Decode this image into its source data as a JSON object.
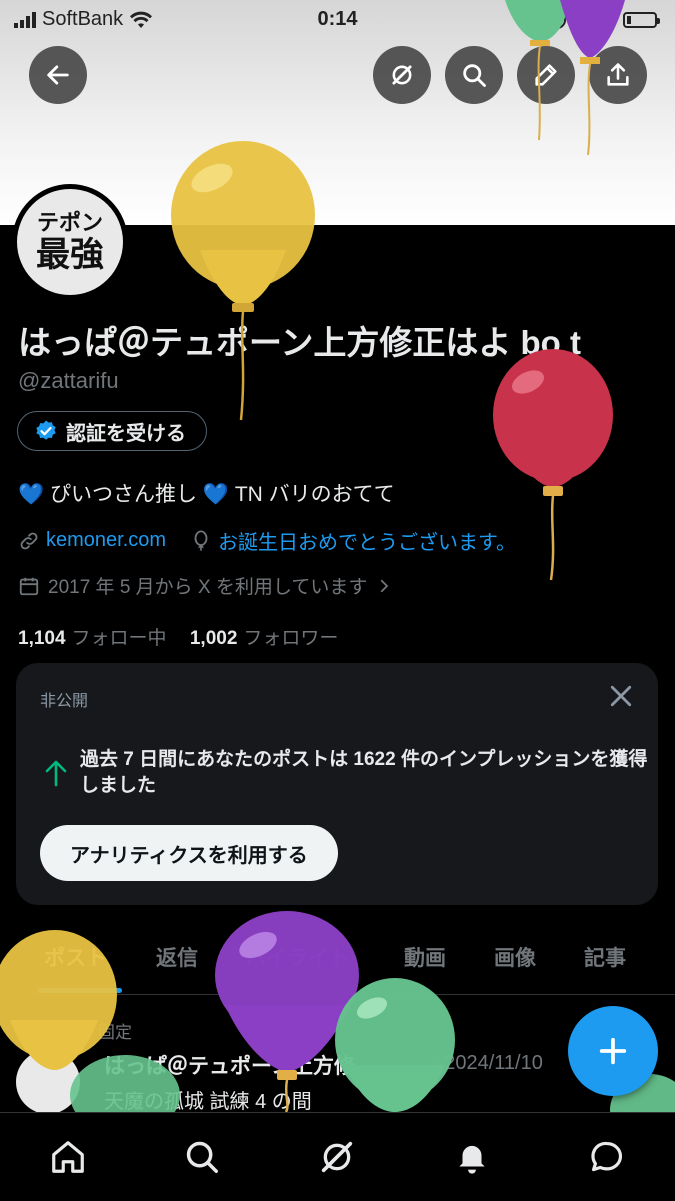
{
  "status_bar": {
    "carrier": "SoftBank",
    "time": "0:14",
    "battery": "14%",
    "battery_level": 0.14
  },
  "profile": {
    "avatar_text_top": "テポン",
    "avatar_text_bottom": "最強",
    "display_name": "はっぱ＠テュポーン上方修正はよ bo t",
    "handle": "@zattarifu",
    "verify_label": "認証を受ける",
    "bio_part1": "ぴいつさん推し",
    "bio_part2": "TN バリのおてて",
    "website": "kemoner.com",
    "birthday": "お誕生日おめでとうございます。",
    "joined": "2017 年 5 月から X を利用しています",
    "following_count": "1,104",
    "following_label": "フォロー中",
    "followers_count": "1,002",
    "followers_label": "フォロワー"
  },
  "analytics_card": {
    "private_label": "非公開",
    "message": "過去 7 日間にあなたのポストは 1622 件のインプレッションを獲得しました",
    "button_label": "アナリティクスを利用する"
  },
  "tabs": [
    {
      "label": "ポスト"
    },
    {
      "label": "返信"
    },
    {
      "label": "ハイライト"
    },
    {
      "label": "動画"
    },
    {
      "label": "画像"
    },
    {
      "label": "記事"
    }
  ],
  "pinned_post": {
    "pinned_label": "固定",
    "author": "はっぱ＠テュポーン上方修...",
    "date": "· 2024/11/10",
    "text": "天魔の孤城 試練 4 の間"
  },
  "colors": {
    "accent": "#1d9bf0",
    "background": "#000000",
    "card": "#16181c",
    "success": "#00ba7c"
  },
  "icons": [
    "back-arrow-icon",
    "grok-icon",
    "search-icon",
    "edit-icon",
    "share-icon",
    "verified-badge-icon",
    "link-icon",
    "balloon-icon",
    "calendar-icon",
    "chevron-right-icon",
    "close-icon",
    "arrow-up-icon",
    "pin-icon",
    "plus-icon",
    "home-icon",
    "notifications-icon",
    "messages-icon"
  ]
}
